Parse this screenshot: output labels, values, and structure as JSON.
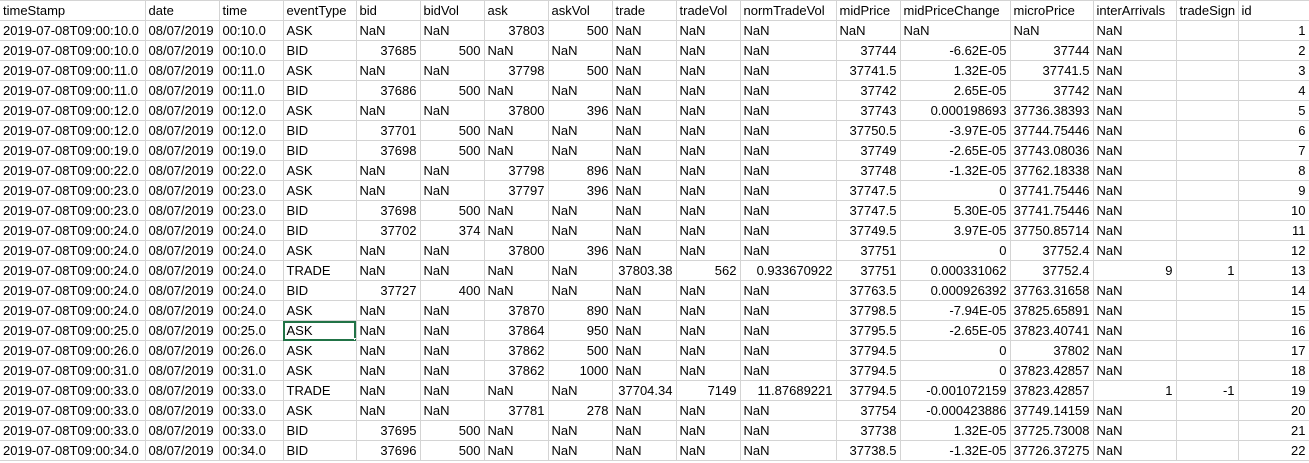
{
  "sheet": {
    "selection_color": "#217346",
    "selected_row": 15,
    "selected_col": 3,
    "columns": [
      "timeStamp",
      "date",
      "time",
      "eventType",
      "bid",
      "bidVol",
      "ask",
      "askVol",
      "trade",
      "tradeVol",
      "normTradeVol",
      "midPrice",
      "midPriceChange",
      "microPrice",
      "interArrivals",
      "tradeSign",
      "id"
    ],
    "rows": [
      [
        "2019-07-08T09:00:10.0",
        "08/07/2019",
        "00:10.0",
        "ASK",
        "NaN",
        "NaN",
        "37803",
        "500",
        "NaN",
        "NaN",
        "NaN",
        "NaN",
        "NaN",
        "NaN",
        "NaN",
        "",
        "1"
      ],
      [
        "2019-07-08T09:00:10.0",
        "08/07/2019",
        "00:10.0",
        "BID",
        "37685",
        "500",
        "NaN",
        "NaN",
        "NaN",
        "NaN",
        "NaN",
        "37744",
        "-6.62E-05",
        "37744",
        "NaN",
        "",
        "2"
      ],
      [
        "2019-07-08T09:00:11.0",
        "08/07/2019",
        "00:11.0",
        "ASK",
        "NaN",
        "NaN",
        "37798",
        "500",
        "NaN",
        "NaN",
        "NaN",
        "37741.5",
        "1.32E-05",
        "37741.5",
        "NaN",
        "",
        "3"
      ],
      [
        "2019-07-08T09:00:11.0",
        "08/07/2019",
        "00:11.0",
        "BID",
        "37686",
        "500",
        "NaN",
        "NaN",
        "NaN",
        "NaN",
        "NaN",
        "37742",
        "2.65E-05",
        "37742",
        "NaN",
        "",
        "4"
      ],
      [
        "2019-07-08T09:00:12.0",
        "08/07/2019",
        "00:12.0",
        "ASK",
        "NaN",
        "NaN",
        "37800",
        "396",
        "NaN",
        "NaN",
        "NaN",
        "37743",
        "0.000198693",
        "37736.38393",
        "NaN",
        "",
        "5"
      ],
      [
        "2019-07-08T09:00:12.0",
        "08/07/2019",
        "00:12.0",
        "BID",
        "37701",
        "500",
        "NaN",
        "NaN",
        "NaN",
        "NaN",
        "NaN",
        "37750.5",
        "-3.97E-05",
        "37744.75446",
        "NaN",
        "",
        "6"
      ],
      [
        "2019-07-08T09:00:19.0",
        "08/07/2019",
        "00:19.0",
        "BID",
        "37698",
        "500",
        "NaN",
        "NaN",
        "NaN",
        "NaN",
        "NaN",
        "37749",
        "-2.65E-05",
        "37743.08036",
        "NaN",
        "",
        "7"
      ],
      [
        "2019-07-08T09:00:22.0",
        "08/07/2019",
        "00:22.0",
        "ASK",
        "NaN",
        "NaN",
        "37798",
        "896",
        "NaN",
        "NaN",
        "NaN",
        "37748",
        "-1.32E-05",
        "37762.18338",
        "NaN",
        "",
        "8"
      ],
      [
        "2019-07-08T09:00:23.0",
        "08/07/2019",
        "00:23.0",
        "ASK",
        "NaN",
        "NaN",
        "37797",
        "396",
        "NaN",
        "NaN",
        "NaN",
        "37747.5",
        "0",
        "37741.75446",
        "NaN",
        "",
        "9"
      ],
      [
        "2019-07-08T09:00:23.0",
        "08/07/2019",
        "00:23.0",
        "BID",
        "37698",
        "500",
        "NaN",
        "NaN",
        "NaN",
        "NaN",
        "NaN",
        "37747.5",
        "5.30E-05",
        "37741.75446",
        "NaN",
        "",
        "10"
      ],
      [
        "2019-07-08T09:00:24.0",
        "08/07/2019",
        "00:24.0",
        "BID",
        "37702",
        "374",
        "NaN",
        "NaN",
        "NaN",
        "NaN",
        "NaN",
        "37749.5",
        "3.97E-05",
        "37750.85714",
        "NaN",
        "",
        "11"
      ],
      [
        "2019-07-08T09:00:24.0",
        "08/07/2019",
        "00:24.0",
        "ASK",
        "NaN",
        "NaN",
        "37800",
        "396",
        "NaN",
        "NaN",
        "NaN",
        "37751",
        "0",
        "37752.4",
        "NaN",
        "",
        "12"
      ],
      [
        "2019-07-08T09:00:24.0",
        "08/07/2019",
        "00:24.0",
        "TRADE",
        "NaN",
        "NaN",
        "NaN",
        "NaN",
        "37803.38",
        "562",
        "0.933670922",
        "37751",
        "0.000331062",
        "37752.4",
        "9",
        "1",
        "13"
      ],
      [
        "2019-07-08T09:00:24.0",
        "08/07/2019",
        "00:24.0",
        "BID",
        "37727",
        "400",
        "NaN",
        "NaN",
        "NaN",
        "NaN",
        "NaN",
        "37763.5",
        "0.000926392",
        "37763.31658",
        "NaN",
        "",
        "14"
      ],
      [
        "2019-07-08T09:00:24.0",
        "08/07/2019",
        "00:24.0",
        "ASK",
        "NaN",
        "NaN",
        "37870",
        "890",
        "NaN",
        "NaN",
        "NaN",
        "37798.5",
        "-7.94E-05",
        "37825.65891",
        "NaN",
        "",
        "15"
      ],
      [
        "2019-07-08T09:00:25.0",
        "08/07/2019",
        "00:25.0",
        "ASK",
        "NaN",
        "NaN",
        "37864",
        "950",
        "NaN",
        "NaN",
        "NaN",
        "37795.5",
        "-2.65E-05",
        "37823.40741",
        "NaN",
        "",
        "16"
      ],
      [
        "2019-07-08T09:00:26.0",
        "08/07/2019",
        "00:26.0",
        "ASK",
        "NaN",
        "NaN",
        "37862",
        "500",
        "NaN",
        "NaN",
        "NaN",
        "37794.5",
        "0",
        "37802",
        "NaN",
        "",
        "17"
      ],
      [
        "2019-07-08T09:00:31.0",
        "08/07/2019",
        "00:31.0",
        "ASK",
        "NaN",
        "NaN",
        "37862",
        "1000",
        "NaN",
        "NaN",
        "NaN",
        "37794.5",
        "0",
        "37823.42857",
        "NaN",
        "",
        "18"
      ],
      [
        "2019-07-08T09:00:33.0",
        "08/07/2019",
        "00:33.0",
        "TRADE",
        "NaN",
        "NaN",
        "NaN",
        "NaN",
        "37704.34",
        "7149",
        "11.87689221",
        "37794.5",
        "-0.001072159",
        "37823.42857",
        "1",
        "-1",
        "19"
      ],
      [
        "2019-07-08T09:00:33.0",
        "08/07/2019",
        "00:33.0",
        "ASK",
        "NaN",
        "NaN",
        "37781",
        "278",
        "NaN",
        "NaN",
        "NaN",
        "37754",
        "-0.000423886",
        "37749.14159",
        "NaN",
        "",
        "20"
      ],
      [
        "2019-07-08T09:00:33.0",
        "08/07/2019",
        "00:33.0",
        "BID",
        "37695",
        "500",
        "NaN",
        "NaN",
        "NaN",
        "NaN",
        "NaN",
        "37738",
        "1.32E-05",
        "37725.73008",
        "NaN",
        "",
        "21"
      ],
      [
        "2019-07-08T09:00:34.0",
        "08/07/2019",
        "00:34.0",
        "BID",
        "37696",
        "500",
        "NaN",
        "NaN",
        "NaN",
        "NaN",
        "NaN",
        "37738.5",
        "-1.32E-05",
        "37726.37275",
        "NaN",
        "",
        "22"
      ]
    ]
  }
}
